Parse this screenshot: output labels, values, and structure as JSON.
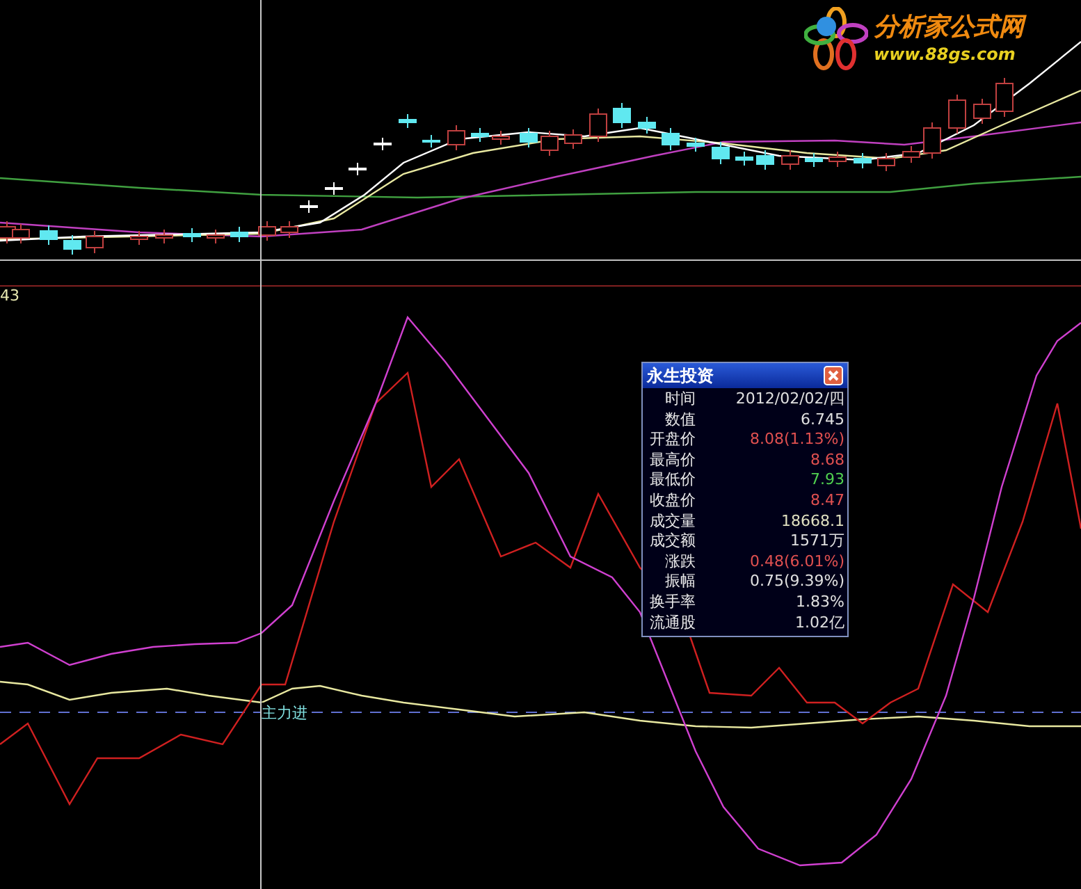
{
  "logo": {
    "title": "分析家公式网",
    "url": "www.88gs.com"
  },
  "indicator_panel": {
    "value_label": "43",
    "signal_label": "主力进"
  },
  "popup": {
    "title": "永生投资",
    "rows": [
      {
        "label": "时间",
        "value": "2012/02/02/四",
        "color": "#e0e0e0"
      },
      {
        "label": "数值",
        "value": "6.745",
        "color": "#e0e0e0"
      },
      {
        "label": "开盘价",
        "value": "8.08(1.13%)",
        "color": "#e05050"
      },
      {
        "label": "最高价",
        "value": "8.68",
        "color": "#e05050"
      },
      {
        "label": "最低价",
        "value": "7.93",
        "color": "#50d050"
      },
      {
        "label": "收盘价",
        "value": "8.47",
        "color": "#e05050"
      },
      {
        "label": "成交量",
        "value": "18668.1",
        "color": "#e0e0c0"
      },
      {
        "label": "成交额",
        "value": "1571万",
        "color": "#e0e0e0"
      },
      {
        "label": "涨跌",
        "value": "0.48(6.01%)",
        "color": "#e05050"
      },
      {
        "label": "振幅",
        "value": "0.75(9.39%)",
        "color": "#e0e0e0"
      },
      {
        "label": "换手率",
        "value": "1.83%",
        "color": "#e0e0e0"
      },
      {
        "label": "流通股",
        "value": "1.02亿",
        "color": "#e0e0e0"
      }
    ]
  }
}
